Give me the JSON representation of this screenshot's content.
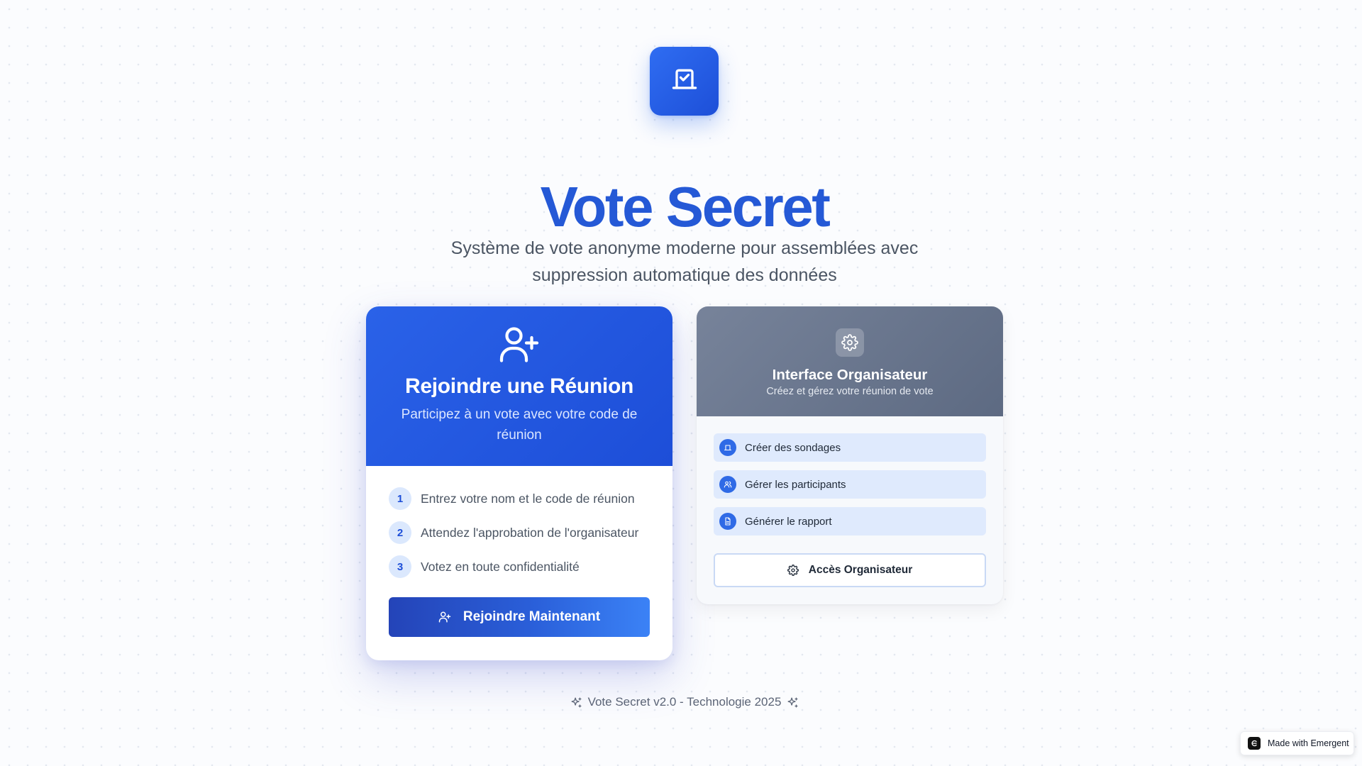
{
  "hero": {
    "title": "Vote Secret",
    "subtitle": "Système de vote anonyme moderne pour assemblées avec suppression automatique des données",
    "logo_icon": "ballot-check-icon"
  },
  "join_card": {
    "icon": "user-plus-icon",
    "title": "Rejoindre une Réunion",
    "subtitle": "Participez à un vote avec votre code de réunion",
    "steps": [
      {
        "number": "1",
        "text": "Entrez votre nom et le code de réunion"
      },
      {
        "number": "2",
        "text": "Attendez l'approbation de l'organisateur"
      },
      {
        "number": "3",
        "text": "Votez en toute confidentialité"
      }
    ],
    "button_label": "Rejoindre Maintenant",
    "button_icon": "user-plus-icon"
  },
  "organizer_card": {
    "icon": "gear-icon",
    "title": "Interface Organisateur",
    "subtitle": "Créez et gérez votre réunion de vote",
    "features": [
      {
        "icon": "ballot-icon",
        "label": "Créer des sondages"
      },
      {
        "icon": "users-icon",
        "label": "Gérer les participants"
      },
      {
        "icon": "file-icon",
        "label": "Générer le rapport"
      }
    ],
    "button_label": "Accès Organisateur",
    "button_icon": "gear-icon"
  },
  "footer": {
    "text": "Vote Secret v2.0 - Technologie 2025",
    "icon": "sparkles-icon"
  },
  "badge": {
    "label": "Made with Emergent"
  },
  "colors": {
    "primary": "#2559d6",
    "primary_gradient_start": "#2a62e8",
    "primary_gradient_end": "#1d4ed8",
    "organizer_header": "#6b778d",
    "feature_bg": "#dfeafd",
    "step_badge_bg": "#dbe8fd"
  }
}
